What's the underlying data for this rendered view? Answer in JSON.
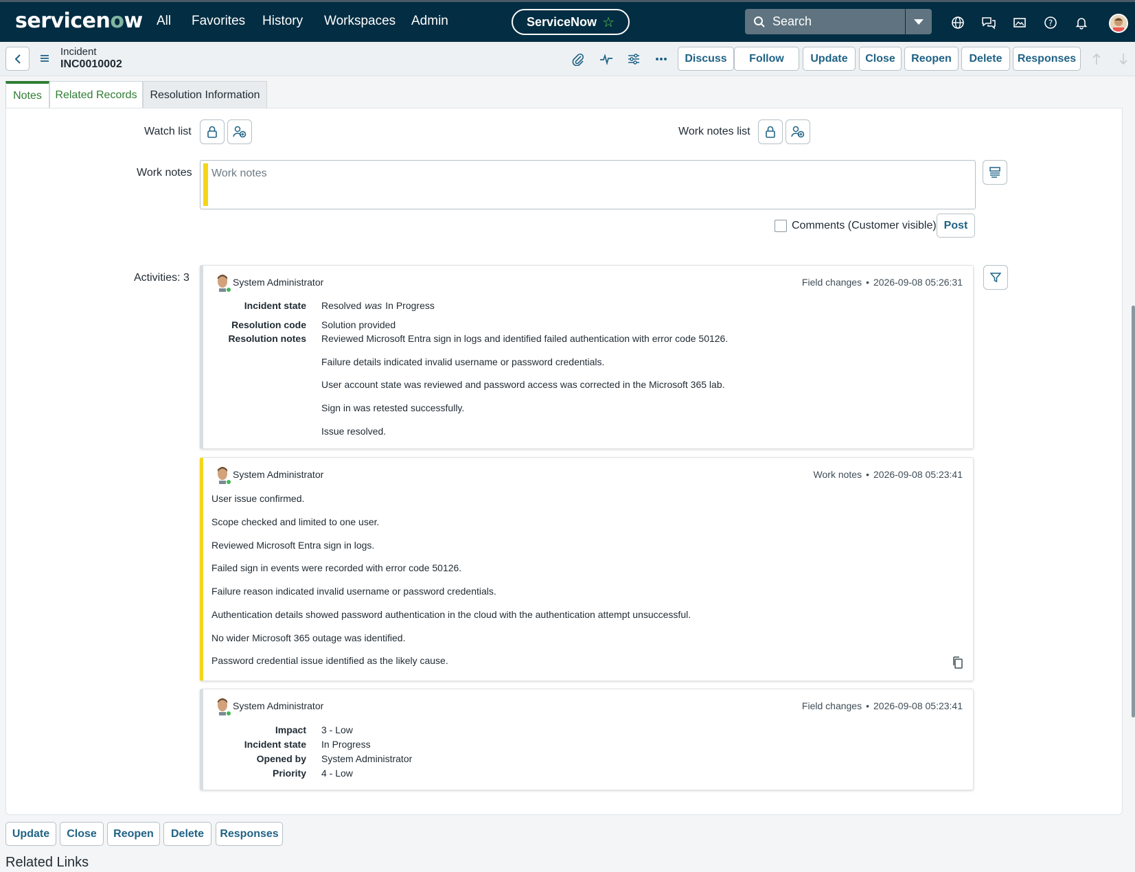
{
  "brand": {
    "logo_pre": "servicen",
    "logo_o": "o",
    "logo_post": "w"
  },
  "nav": {
    "items": [
      "All",
      "Favorites",
      "History",
      "Workspaces",
      "Admin"
    ],
    "app_pill": "ServiceNow",
    "search_placeholder": "Search"
  },
  "record": {
    "table": "Incident",
    "number": "INC0010002"
  },
  "header_buttons": [
    "Discuss",
    "Follow",
    "Update",
    "Close",
    "Reopen",
    "Delete",
    "Responses"
  ],
  "tabs": [
    "Notes",
    "Related Records",
    "Resolution Information"
  ],
  "form": {
    "watch_list": "Watch list",
    "work_notes_list": "Work notes list",
    "work_notes_label": "Work notes",
    "work_notes_placeholder": "Work notes",
    "comments_checkbox": "Comments (Customer visible)",
    "post": "Post",
    "activities": "Activities: 3"
  },
  "activities": [
    {
      "author": "System Administrator",
      "type": "Field changes",
      "timestamp": "2026-09-08 05:26:31",
      "fields": [
        {
          "name": "Incident state",
          "value": "Resolved",
          "was": "was",
          "old": "In Progress"
        },
        {
          "name": "Resolution code",
          "value": "Solution provided"
        },
        {
          "name": "Resolution notes",
          "lines": [
            "Reviewed Microsoft Entra sign in logs and identified failed authentication with error code 50126.",
            "Failure details indicated invalid username or password credentials.",
            "User account state was reviewed and password access was corrected in the Microsoft 365 lab.",
            "Sign in was retested successfully.",
            "Issue resolved."
          ]
        }
      ]
    },
    {
      "author": "System Administrator",
      "type": "Work notes",
      "timestamp": "2026-09-08 05:23:41",
      "lines": [
        "User issue confirmed.",
        "Scope checked and limited to one user.",
        "Reviewed Microsoft Entra sign in logs.",
        "Failed sign in events were recorded with error code 50126.",
        "Failure reason indicated invalid username or password credentials.",
        "Authentication details showed password authentication in the cloud with the authentication attempt unsuccessful.",
        "No wider Microsoft 365 outage was identified.",
        "Password credential issue identified as the likely cause."
      ]
    },
    {
      "author": "System Administrator",
      "type": "Field changes",
      "timestamp": "2026-09-08 05:23:41",
      "fields": [
        {
          "name": "Impact",
          "value": "3 - Low"
        },
        {
          "name": "Incident state",
          "value": "In Progress"
        },
        {
          "name": "Opened by",
          "value": "System Administrator"
        },
        {
          "name": "Priority",
          "value": "4 - Low"
        }
      ]
    }
  ],
  "footer_buttons": [
    "Update",
    "Close",
    "Reopen",
    "Delete",
    "Responses"
  ],
  "related_links": "Related Links",
  "colors": {
    "nav_bg": "#032d42",
    "accent": "#1f6285",
    "tab_active": "#2e7d32",
    "work_notes_bar": "#f5d51a",
    "online": "#3fb950"
  }
}
